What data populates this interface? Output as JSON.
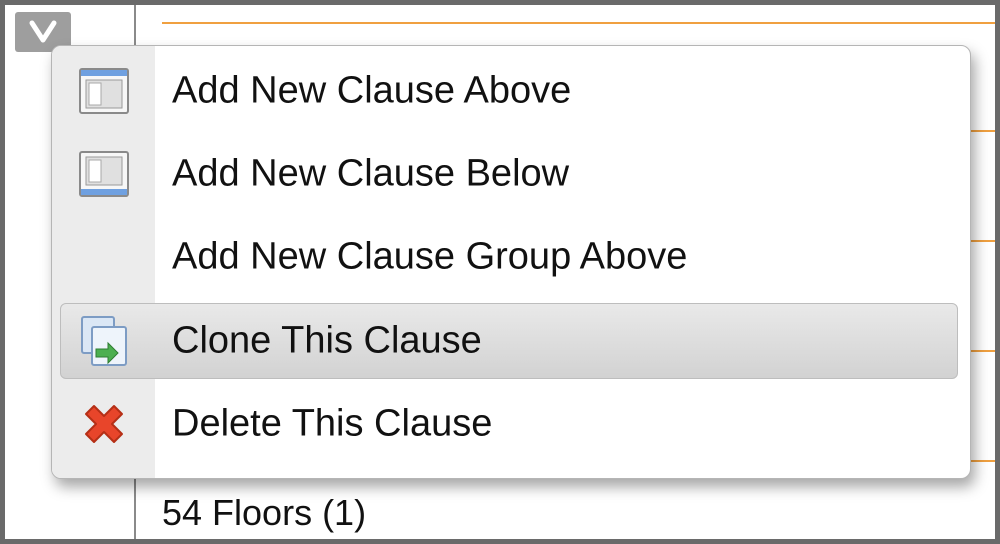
{
  "toggle": {
    "icon": "chevron-down-icon"
  },
  "menu": {
    "items": [
      {
        "label": "Add New Clause Above",
        "icon": "clause-above-icon"
      },
      {
        "label": "Add New Clause Below",
        "icon": "clause-below-icon"
      },
      {
        "label": "Add New Clause Group Above",
        "icon": ""
      },
      {
        "label": "Clone This Clause",
        "icon": "clone-icon",
        "highlighted": true
      },
      {
        "label": "Delete This Clause",
        "icon": "delete-x-icon"
      }
    ]
  },
  "background": {
    "row_text": "54 Floors (1)",
    "accent_color": "#f0a040"
  }
}
